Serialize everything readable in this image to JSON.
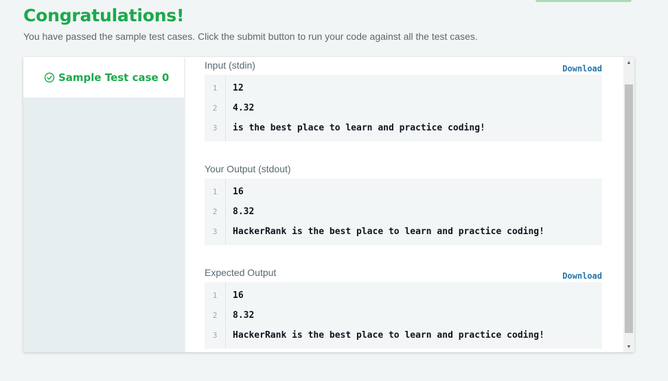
{
  "header": {
    "title": "Congratulations!",
    "subtitle": "You have passed the sample test cases. Click the submit button to run your code against all the test cases."
  },
  "tabs": [
    {
      "label": "Sample Test case 0",
      "status": "passed",
      "icon": "check-circle-icon"
    }
  ],
  "sections": [
    {
      "title": "Input (stdin)",
      "download_label": "Download",
      "lines": [
        {
          "n": "1",
          "text": "12"
        },
        {
          "n": "2",
          "text": "4.32"
        },
        {
          "n": "3",
          "text": "is the best place to learn and practice coding!"
        }
      ]
    },
    {
      "title": "Your Output (stdout)",
      "lines": [
        {
          "n": "1",
          "text": "16"
        },
        {
          "n": "2",
          "text": "8.32"
        },
        {
          "n": "3",
          "text": "HackerRank is the best place to learn and practice coding!"
        }
      ]
    },
    {
      "title": "Expected Output",
      "download_label": "Download",
      "lines": [
        {
          "n": "1",
          "text": "16"
        },
        {
          "n": "2",
          "text": "8.32"
        },
        {
          "n": "3",
          "text": "HackerRank is the best place to learn and practice coding!"
        }
      ]
    }
  ],
  "colors": {
    "success_green": "#1ba94c",
    "link_blue": "#2875a8",
    "text_gray": "#576871"
  }
}
